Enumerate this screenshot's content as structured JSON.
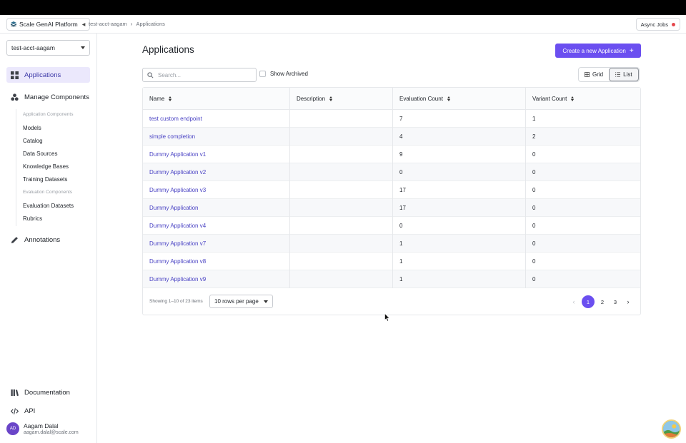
{
  "header": {
    "brand": "Scale GenAI Platform",
    "breadcrumb": [
      "test-acct-aagam",
      "Applications"
    ],
    "async_jobs": "Async Jobs"
  },
  "sidebar": {
    "account": "test-acct-aagam",
    "nav": {
      "applications": "Applications",
      "manage_components": "Manage Components",
      "annotations": "Annotations",
      "documentation": "Documentation",
      "api": "API"
    },
    "app_components_heading": "Application Components",
    "app_components": [
      "Models",
      "Catalog",
      "Data Sources",
      "Knowledge Bases",
      "Training Datasets"
    ],
    "eval_components_heading": "Evaluation Components",
    "eval_components": [
      "Evaluation Datasets",
      "Rubrics"
    ],
    "user": {
      "initials": "AD",
      "name": "Aagam Dalal",
      "email": "aagam.dalal@scale.com"
    }
  },
  "main": {
    "title": "Applications",
    "create_button": "Create a new Application",
    "search_placeholder": "Search...",
    "show_archived": "Show Archived",
    "view_grid": "Grid",
    "view_list": "List",
    "columns": [
      "Name",
      "Description",
      "Evaluation Count",
      "Variant Count"
    ],
    "rows": [
      {
        "name": "test custom endpoint",
        "description": "",
        "evaluation_count": "7",
        "variant_count": "1"
      },
      {
        "name": "simple completion",
        "description": "",
        "evaluation_count": "4",
        "variant_count": "2"
      },
      {
        "name": "Dummy Application v1",
        "description": "",
        "evaluation_count": "9",
        "variant_count": "0"
      },
      {
        "name": "Dummy Application v2",
        "description": "",
        "evaluation_count": "0",
        "variant_count": "0"
      },
      {
        "name": "Dummy Application v3",
        "description": "",
        "evaluation_count": "17",
        "variant_count": "0"
      },
      {
        "name": "Dummy Application",
        "description": "",
        "evaluation_count": "17",
        "variant_count": "0"
      },
      {
        "name": "Dummy Application v4",
        "description": "",
        "evaluation_count": "0",
        "variant_count": "0"
      },
      {
        "name": "Dummy Application v7",
        "description": "",
        "evaluation_count": "1",
        "variant_count": "0"
      },
      {
        "name": "Dummy Application v8",
        "description": "",
        "evaluation_count": "1",
        "variant_count": "0"
      },
      {
        "name": "Dummy Application v9",
        "description": "",
        "evaluation_count": "1",
        "variant_count": "0"
      }
    ],
    "showing": "Showing 1–10 of 23 items",
    "rows_per_page": "10 rows per page",
    "pages": [
      "1",
      "2",
      "3"
    ],
    "current_page": "1"
  },
  "colors": {
    "accent": "#6b4ff0",
    "link": "#4a43c4",
    "active_nav_bg": "#ebe8fc",
    "status_dot": "#e5484d"
  }
}
